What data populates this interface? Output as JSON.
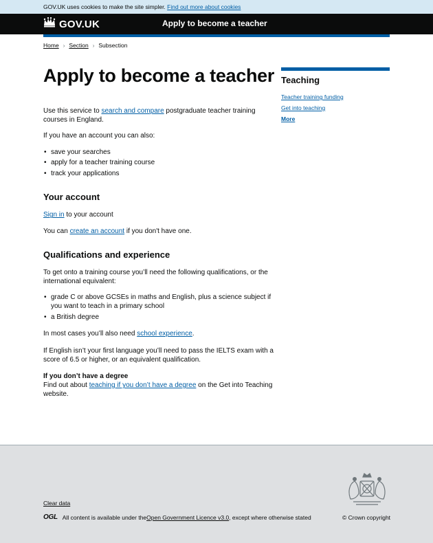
{
  "cookie_banner": {
    "text": "GOV.UK uses cookies to make the site simpler.",
    "link": "Find out more about cookies"
  },
  "header": {
    "logo_text": "GOV.UK",
    "service_name": "Apply to become a teacher"
  },
  "breadcrumbs": [
    "Home",
    "Section",
    "Subsection"
  ],
  "page_title": "Apply to become a teacher",
  "intro": {
    "text_before": "Use this service to ",
    "link": "search and compare",
    "text_after": " postgraduate teacher training courses in England."
  },
  "account_intro": "If you have an account you can also:",
  "account_list": [
    "save your searches",
    "apply for a teacher training course",
    "track your applications"
  ],
  "your_account": {
    "heading": "Your account",
    "sign_in_link": "Sign in",
    "sign_in_after": " to your account",
    "create_before": "You can ",
    "create_link": "create an account",
    "create_after": " if you don't have one."
  },
  "qualifications": {
    "heading": "Qualifications and experience",
    "intro": "To get onto a training course you’ll need the following qualifications, or the international equivalent:",
    "list": [
      "grade C or above GCSEs in maths and English, plus a science subject if you want to teach in a primary school",
      "a British degree"
    ],
    "school_before": "In most cases you’ll also need ",
    "school_link": "school experience",
    "school_after": ".",
    "ielts": "If English isn’t your first language you’ll need to pass the IELTS exam with a score of 6.5 or higher, or an equivalent qualification."
  },
  "no_degree": {
    "heading": "If you don’t have a degree",
    "before": "Find out about ",
    "link": "teaching if you don’t have a degree",
    "after": " on the Get into Teaching website."
  },
  "sidebar": {
    "heading": "Teaching",
    "links": [
      "Teacher training funding",
      "Get into teaching"
    ],
    "more": "More"
  },
  "footer": {
    "clear_data": "Clear data",
    "ogl": "OGL",
    "licence_before": "All content is available under the ",
    "licence_link": "Open Government Licence v3.0",
    "licence_after": ", except where otherwise stated",
    "copyright": "© Crown copyright"
  },
  "colors": {
    "link": "#005ea5",
    "header_bg": "#0b0c0c",
    "cookie_bg": "#d5e8f3",
    "footer_bg": "#dee0e2"
  }
}
